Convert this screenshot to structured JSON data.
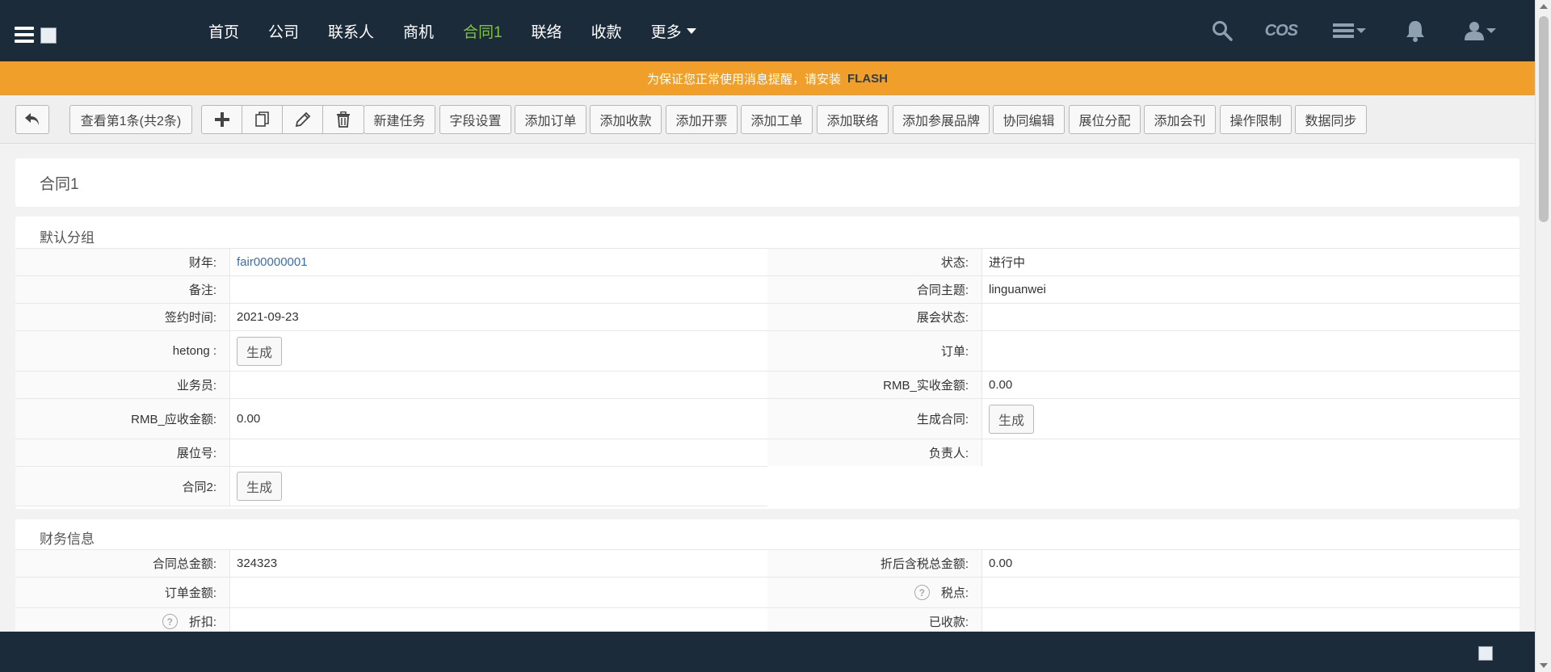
{
  "nav": {
    "items": [
      {
        "label": "首页"
      },
      {
        "label": "公司"
      },
      {
        "label": "联系人"
      },
      {
        "label": "商机"
      },
      {
        "label": "合同1"
      },
      {
        "label": "联络"
      },
      {
        "label": "收款"
      },
      {
        "label": "更多"
      }
    ],
    "active_index": 4,
    "cos_label": "COS",
    "active_color": "#7ec33a",
    "bg_color": "#1c2b3a"
  },
  "flash": {
    "message": "为保证您正常使用消息提醒，请安装",
    "highlight": "FLASH",
    "bg_color": "#f0a02a"
  },
  "toolbar": {
    "back_icon": "back-arrow-icon",
    "view_label": "查看第1条(共2条)",
    "group_icons": [
      "plus-icon",
      "copy-icon",
      "edit-icon",
      "trash-icon"
    ],
    "buttons": [
      "新建任务",
      "字段设置",
      "添加订单",
      "添加收款",
      "添加开票",
      "添加工单",
      "添加联络",
      "添加参展品牌",
      "协同编辑",
      "展位分配",
      "添加会刊",
      "操作限制",
      "数据同步"
    ]
  },
  "record": {
    "title": "合同1"
  },
  "sections": {
    "default": {
      "title": "默认分组",
      "rows": [
        {
          "l1": "财年:",
          "v1": "fair00000001",
          "l2": "状态:",
          "v2": "进行中"
        },
        {
          "l1": "备注:",
          "v1": "",
          "l2": "合同主题:",
          "v2": "linguanwei"
        },
        {
          "l1": "签约时间:",
          "v1": "2021-09-23",
          "l2": "展会状态:",
          "v2": ""
        },
        {
          "l1": "hetong :",
          "v1_button": "生成",
          "l2": "订单:",
          "v2": ""
        },
        {
          "l1": "业务员:",
          "v1": "",
          "l2": "RMB_实收金额:",
          "v2": "0.00"
        },
        {
          "l1": "RMB_应收金额:",
          "v1": "0.00",
          "l2": "生成合同:",
          "v2_button": "生成"
        },
        {
          "l1": "展位号:",
          "v1": "",
          "l2": "负责人:",
          "v2": ""
        },
        {
          "l1": "合同2:",
          "v1_button": "生成"
        }
      ]
    },
    "finance": {
      "title": "财务信息",
      "rows": [
        {
          "l1": "合同总金额:",
          "v1": "324323",
          "l2": "折后含税总金额:",
          "v2": "0.00"
        },
        {
          "l1": "订单金额:",
          "v1": "",
          "l2": "税点:",
          "v2": ""
        },
        {
          "l1": "折扣:",
          "v1": "",
          "l2": "已收款:",
          "v2": ""
        }
      ]
    }
  }
}
